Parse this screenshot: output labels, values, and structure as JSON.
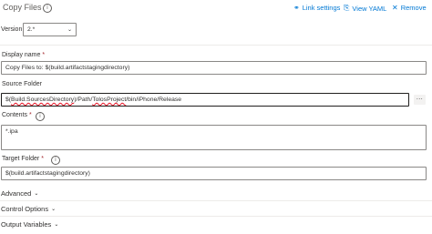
{
  "task": {
    "title": "Copy Files",
    "links": {
      "link_settings": "Link settings",
      "view_yaml": "View YAML",
      "remove": "Remove"
    }
  },
  "version": {
    "label": "Version",
    "value": "2.*"
  },
  "fields": {
    "display_name": {
      "label": "Display name",
      "value": "Copy Files to: $(build.artifactstagingdirectory)"
    },
    "source_folder": {
      "label": "Source Folder",
      "value_parts": [
        "$(",
        "Build.SourcesDirectory",
        ")/Path/",
        "TolosProject",
        "/bin/iPhone/Release"
      ],
      "browse_label": "..."
    },
    "contents": {
      "label": "Contents",
      "value": "*.ipa"
    },
    "target_folder": {
      "label": "Target Folder",
      "value": "$(build.artifactstagingdirectory)"
    }
  },
  "sections": {
    "advanced": "Advanced",
    "control_options": "Control Options",
    "output_variables": "Output Variables"
  },
  "icons": {
    "info": "info-icon",
    "link": "link-icon",
    "yaml": "clipboard-icon",
    "remove": "close-icon",
    "chevron": "chevron-down-icon"
  }
}
